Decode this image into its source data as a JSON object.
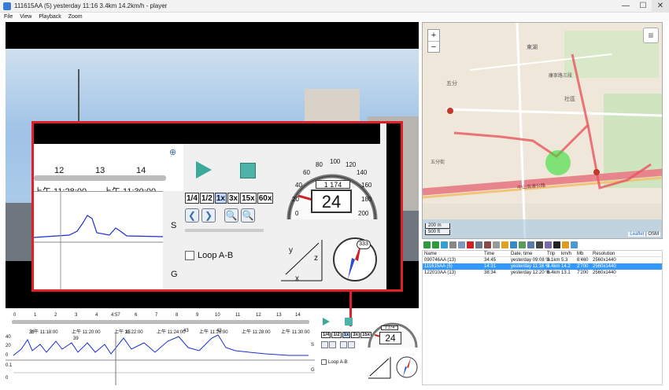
{
  "window": {
    "title": "111615AA (5)    yesterday 11:16    3.4km    14.2km/h  -  player",
    "buttons": {
      "minimize": "—",
      "maximize": "☐",
      "close": "✕"
    }
  },
  "menu": [
    "File",
    "View",
    "Playback",
    "Zoom"
  ],
  "timeline": {
    "zoom_hours": [
      "12",
      "13",
      "14"
    ],
    "labels": [
      "上午 11:28:00",
      "上午 11:30:00"
    ],
    "mini_hours": [
      "0",
      "1",
      "2",
      "3",
      "4",
      "5",
      "6",
      "7",
      "8",
      "9",
      "10",
      "11",
      "12",
      "13",
      "14"
    ],
    "mini_labels": [
      "上午 11:18:00",
      "上午 11:20:00",
      "上午 11:22:00",
      "上午 11:24:00",
      "上午 11:26:00",
      "上午 11:28:00",
      "上午 11:30:00"
    ],
    "cursor": "4:57"
  },
  "graph": {
    "s_label": "S",
    "g_label": "G",
    "y_ticks": [
      "40",
      "20",
      "0",
      "0.1",
      "0"
    ],
    "peaks": [
      "36",
      "35",
      "43",
      "43",
      "39"
    ]
  },
  "controls": {
    "speeds": [
      "1/4",
      "1/2",
      "1x",
      "3x",
      "15x",
      "60x"
    ],
    "active_speed": "1x",
    "prev": "❮",
    "next": "❯",
    "zoom_out": "🔍",
    "zoom_in": "🔍",
    "loop_label": "Loop A-B"
  },
  "speedometer": {
    "speed": "24",
    "odometer": "1 174",
    "ticks": [
      "0",
      "20",
      "40",
      "60",
      "80",
      "100",
      "120",
      "140",
      "160",
      "180",
      "200"
    ]
  },
  "compass": {
    "heading": "333"
  },
  "axes": {
    "x": "x",
    "y": "y",
    "z": "z"
  },
  "map": {
    "zoom_in": "+",
    "zoom_out": "−",
    "layers": "≡",
    "scale_m": "200 m",
    "scale_ft": "500 ft",
    "attrib_link": "Leaflet",
    "attrib_osm": "| OSM",
    "labels": [
      "五分",
      "社區",
      "東湖",
      "中山高速公路",
      "康寧路三段",
      "五分街"
    ]
  },
  "filelist": {
    "columns": [
      "Name",
      "Time",
      "Date, time",
      "Trip",
      "km/h",
      "Mb",
      "Resolution"
    ],
    "rows": [
      {
        "name": "090746AA (13)",
        "time": "34:45",
        "date": "yesterday 09:08 %",
        "trip": "3.1km",
        "kmh": "5.3",
        "mb": "6'460",
        "res": "2560x1440"
      },
      {
        "name": "111615AA (5)",
        "time": "14:31",
        "date": "yesterday 11:16 %",
        "trip": "3.4km",
        "kmh": "14.2",
        "mb": "2'700",
        "res": "2560x1440"
      },
      {
        "name": "122010AA (13)",
        "time": "38:34",
        "date": "yesterday 12:20 %",
        "trip": "8.4km",
        "kmh": "13.1",
        "mb": "7'200",
        "res": "2560x1440"
      }
    ],
    "selected_index": 1
  }
}
